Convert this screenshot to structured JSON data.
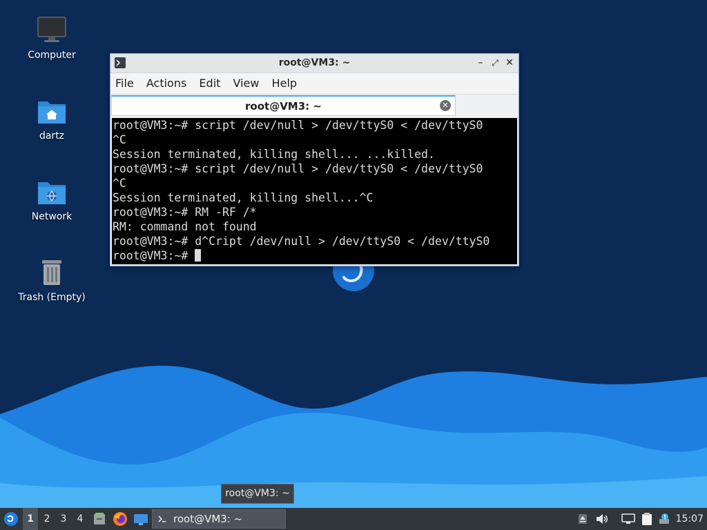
{
  "desktop": {
    "icons": [
      {
        "label": "Computer",
        "icon": "monitor-icon"
      },
      {
        "label": "dartz",
        "icon": "home-folder-icon"
      },
      {
        "label": "Network",
        "icon": "network-folder-icon"
      },
      {
        "label": "Trash (Empty)",
        "icon": "trash-icon"
      }
    ]
  },
  "terminal": {
    "title": "root@VM3: ~",
    "menu": [
      "File",
      "Actions",
      "Edit",
      "View",
      "Help"
    ],
    "tab_label": "root@VM3: ~",
    "lines": [
      "root@VM3:~# script /dev/null > /dev/ttyS0 < /dev/ttyS0",
      "^C",
      "Session terminated, killing shell... ...killed.",
      "root@VM3:~# script /dev/null > /dev/ttyS0 < /dev/ttyS0",
      "^C",
      "Session terminated, killing shell...^C",
      "root@VM3:~# RM -RF /*",
      "RM: command not found",
      "root@VM3:~# d^Cript /dev/null > /dev/ttyS0 < /dev/ttyS0"
    ],
    "prompt": "root@VM3:~# "
  },
  "tooltip": {
    "text": "root@VM3: ~"
  },
  "taskbar": {
    "workspaces": [
      "1",
      "2",
      "3",
      "4"
    ],
    "task_label": "root@VM3: ~",
    "clock": "15:07"
  },
  "colors": {
    "accent": "#3daee9",
    "console_bg": "#000000",
    "console_fg": "#dcdcdc",
    "taskbar_bg": "#31363b"
  }
}
